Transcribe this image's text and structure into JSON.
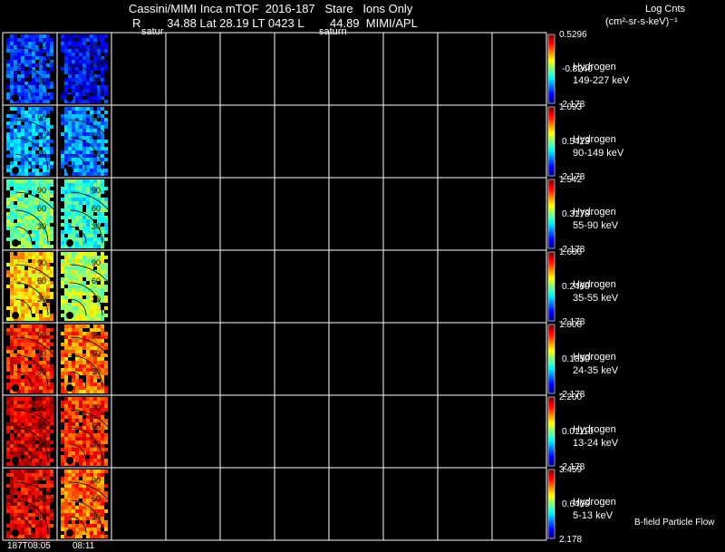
{
  "header": {
    "title": "Cassini/MIMI Inca mTOF  2016-187   Stare   Ions Only",
    "subtitle": "R        34.88 Lat 28.19 LT 0423 L        44.89  MIMI/APL",
    "units_line1": "Log Cnts",
    "units_line2": "(cm²-sr-s-keV)⁻¹",
    "satur_labels": [
      "satur",
      "saturn"
    ]
  },
  "time_labels": [
    "187T08:05",
    "08:11"
  ],
  "footer_label": "B-field Particle Flow",
  "latitude_labels": [
    "90",
    "60",
    "30"
  ],
  "channels": [
    {
      "species": "Hydrogen",
      "energy": "149-227 keV",
      "cb_max": "0.5296",
      "cb_mid": "-0.8240",
      "cb_min": "-2.178",
      "level1": 0.18,
      "level2": 0.12
    },
    {
      "species": "Hydrogen",
      "energy": "90-149 keV",
      "cb_max": "1.093",
      "cb_mid": "0.5423",
      "cb_min": "-2.178",
      "level1": 0.28,
      "level2": 0.25
    },
    {
      "species": "Hydrogen",
      "energy": "55-90 keV",
      "cb_max": "1.542",
      "cb_mid": "0.3178",
      "cb_min": "-2.178",
      "level1": 0.48,
      "level2": 0.42
    },
    {
      "species": "Hydrogen",
      "energy": "35-55 keV",
      "cb_max": "1.686",
      "cb_mid": "0.2460",
      "cb_min": "-2.178",
      "level1": 0.68,
      "level2": 0.55
    },
    {
      "species": "Hydrogen",
      "energy": "24-35 keV",
      "cb_max": "1.808",
      "cb_mid": "0.1850",
      "cb_min": "-2.178",
      "level1": 0.84,
      "level2": 0.76
    },
    {
      "species": "Hydrogen",
      "energy": "13-24 keV",
      "cb_max": "2.200",
      "cb_mid": "0.01110",
      "cb_min": "-2.178",
      "level1": 0.92,
      "level2": 0.84
    },
    {
      "species": "Hydrogen",
      "energy": "5-13 keV",
      "cb_max": "3.459",
      "cb_mid": "0.6406",
      "cb_min": "2.178",
      "level1": 0.9,
      "level2": 0.78
    }
  ],
  "chart_data": {
    "type": "heatmap",
    "title": "Cassini/MIMI Inca mTOF  2016-187   Stare   Ions Only",
    "colorbar_label": "Log Cnts (cm²-sr-s-keV)⁻¹",
    "x_tick_labels": [
      "187T08:05",
      "08:11"
    ],
    "grid": true,
    "columns_with_data": 2,
    "empty_columns": 8,
    "series": [
      {
        "name": "Hydrogen 149-227 keV",
        "range": [
          -2.178,
          0.5296
        ]
      },
      {
        "name": "Hydrogen 90-149 keV",
        "range": [
          -2.178,
          1.093
        ]
      },
      {
        "name": "Hydrogen 55-90 keV",
        "range": [
          -2.178,
          1.542
        ]
      },
      {
        "name": "Hydrogen 35-55 keV",
        "range": [
          -2.178,
          1.686
        ]
      },
      {
        "name": "Hydrogen 24-35 keV",
        "range": [
          -2.178,
          1.808
        ]
      },
      {
        "name": "Hydrogen 13-24 keV",
        "range": [
          -2.178,
          2.2
        ]
      },
      {
        "name": "Hydrogen 5-13 keV",
        "range": [
          2.178,
          3.459
        ]
      }
    ]
  }
}
